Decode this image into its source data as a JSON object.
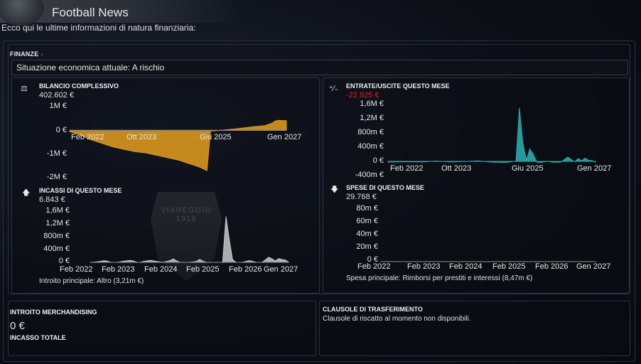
{
  "app": {
    "title": "Football News"
  },
  "subtitle": "Ecco qui le ultime informazioni di natura finanziaria:",
  "finance": {
    "section_label": "FINANZE",
    "status": "Situazione economica attuale: A rischio"
  },
  "watermark": {
    "text": "VIAREGGIO 1919"
  },
  "blocks": {
    "balance": {
      "title": "BILANCIO COMPLESSIVO",
      "value": "402.602 €"
    },
    "income": {
      "title": "INCASSI DI QUESTO MESE",
      "value": "6.843 €",
      "caption": "Introito principale:  Altro (3,21m €)"
    },
    "inout": {
      "title": "ENTRATE/USCITE QUESTO MESE",
      "value": "-22.925 €"
    },
    "expenses": {
      "title": "SPESE DI QUESTO MESE",
      "value": "29.768 €",
      "caption": "Spesa principale:  Rimborsi per prestiti e interessi (8,47m €)"
    }
  },
  "merch": {
    "title": "INTROITO MERCHANDISING",
    "value": "0 €",
    "total_label": "INCASSO TOTALE"
  },
  "transfer": {
    "title": "CLAUSOLE DI TRASFERIMENTO",
    "text": "Clausole di riscatto al momento non disponibili."
  },
  "colors": {
    "balance": "#d9961f",
    "income": "#c8c8c8",
    "inout": "#2aa8a8",
    "expenses": "#72b53c",
    "negative": "#e02424"
  },
  "icons": {
    "balance": "scale-icon",
    "inout": "plus-minus-icon",
    "income": "arrow-up-icon",
    "expenses": "arrow-down-icon"
  },
  "chart_data": [
    {
      "type": "area",
      "title": "BILANCIO COMPLESSIVO",
      "x_ticks": [
        "Feb 2022",
        "Ott 2023",
        "Giu 2025",
        "Gen 2027"
      ],
      "y_ticks": [
        "1M €",
        "0 €",
        "-1M €",
        "-2M €"
      ],
      "ylim": [
        -2000000,
        1000000
      ],
      "x_range": [
        0,
        60
      ],
      "x": [
        0,
        3,
        6,
        9,
        12,
        15,
        18,
        21,
        24,
        27,
        30,
        33,
        36,
        38,
        39,
        40,
        42,
        45,
        48,
        51,
        54,
        56,
        57,
        58,
        60
      ],
      "values": [
        -50000,
        -200000,
        -400000,
        -550000,
        -700000,
        -800000,
        -900000,
        -950000,
        -1050000,
        -1150000,
        -1250000,
        -1400000,
        -1550000,
        -1700000,
        -30000,
        -20000,
        0,
        50000,
        100000,
        150000,
        200000,
        300000,
        400000,
        420000,
        402602
      ]
    },
    {
      "type": "area",
      "title": "INCASSI DI QUESTO MESE",
      "x_ticks": [
        "Feb 2022",
        "Feb 2023",
        "Feb 2024",
        "Feb 2025",
        "Feb 2026",
        "Gen 2027"
      ],
      "y_ticks": [
        "1,6M €",
        "1,2M €",
        "800m €",
        "400m €",
        "0 €"
      ],
      "ylim": [
        0,
        1800000
      ],
      "x_range": [
        0,
        60
      ],
      "x": [
        0,
        2,
        4,
        5,
        6,
        8,
        10,
        12,
        13,
        14,
        15,
        16,
        18,
        20,
        22,
        24,
        25,
        26,
        27,
        28,
        30,
        32,
        33,
        34,
        35,
        36,
        38,
        40,
        41,
        42,
        43,
        44,
        46,
        48,
        49,
        50,
        52,
        54,
        55,
        56,
        57,
        58,
        59,
        60
      ],
      "values": [
        0,
        20000,
        60000,
        40000,
        0,
        0,
        40000,
        70000,
        40000,
        0,
        0,
        30000,
        70000,
        30000,
        0,
        60000,
        120000,
        50000,
        0,
        0,
        0,
        30000,
        100000,
        40000,
        0,
        0,
        0,
        0,
        1600000,
        800000,
        100000,
        0,
        0,
        60000,
        40000,
        0,
        0,
        180000,
        120000,
        50000,
        130000,
        100000,
        80000,
        6843
      ]
    },
    {
      "type": "area",
      "title": "ENTRATE/USCITE QUESTO MESE",
      "x_ticks": [
        "Feb 2022",
        "Ott 2023",
        "Giu 2025",
        "Gen 2027"
      ],
      "y_ticks": [
        "1,6M €",
        "1,2M €",
        "800m €",
        "400m €",
        "0 €",
        "-400m €"
      ],
      "ylim": [
        -400000,
        1600000
      ],
      "x_range": [
        0,
        60
      ],
      "x": [
        0,
        5,
        10,
        14,
        18,
        22,
        26,
        30,
        34,
        37,
        38,
        39,
        40,
        41,
        42,
        43,
        44,
        46,
        48,
        50,
        52,
        53,
        54,
        55,
        56,
        57,
        58,
        59,
        60
      ],
      "values": [
        -20000,
        -10000,
        -15000,
        10000,
        -15000,
        -5000,
        15000,
        -20000,
        -30000,
        10000,
        1500000,
        500000,
        40000,
        350000,
        200000,
        -20000,
        -30000,
        0,
        -25000,
        -20000,
        120000,
        50000,
        -10000,
        80000,
        20000,
        90000,
        30000,
        20000,
        -22925
      ]
    },
    {
      "type": "area",
      "title": "SPESE DI QUESTO MESE",
      "x_ticks": [
        "Feb 2022",
        "Feb 2023",
        "Feb 2024",
        "Feb 2025",
        "Feb 2026",
        "Gen 2027"
      ],
      "y_ticks": [
        "80m €",
        "60m €",
        "40m €",
        "20m €",
        "0 €"
      ],
      "ylim": [
        0,
        85000000
      ],
      "x_range": [
        0,
        60
      ],
      "x": [
        0,
        1,
        2,
        3,
        4,
        5,
        6,
        7,
        8,
        9,
        10,
        11,
        12,
        13,
        14,
        15,
        16,
        17,
        18,
        19,
        20,
        21,
        22,
        23,
        24,
        25,
        26,
        27,
        28,
        29,
        30,
        31,
        32,
        33,
        34,
        35,
        36,
        37,
        38,
        39,
        40,
        41,
        42,
        43,
        44,
        45,
        46,
        47,
        48,
        49,
        50,
        51,
        52,
        53,
        54,
        55,
        56,
        57,
        58,
        59,
        60
      ],
      "values": [
        66,
        62,
        60,
        68,
        62,
        58,
        64,
        60,
        62,
        56,
        66,
        58,
        62,
        54,
        64,
        58,
        66,
        60,
        44,
        48,
        42,
        46,
        40,
        48,
        42,
        50,
        44,
        48,
        52,
        58,
        48,
        54,
        50,
        60,
        54,
        58,
        52,
        60,
        54,
        64,
        56,
        46,
        38,
        40,
        34,
        36,
        34,
        36,
        30,
        30,
        28,
        32,
        34,
        30,
        36,
        38,
        34,
        36,
        38,
        34,
        30
      ]
    }
  ]
}
